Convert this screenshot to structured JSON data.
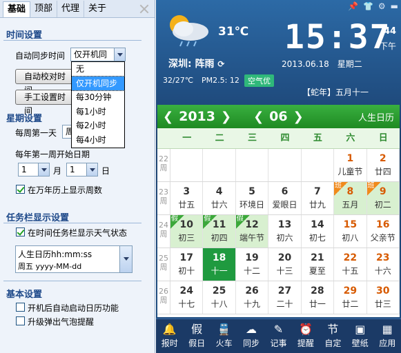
{
  "settings": {
    "tabs": [
      "基础",
      "顶部",
      "代理",
      "关于"
    ],
    "time_section": "时间设置",
    "auto_sync_label": "自动同步时间",
    "auto_sync_value": "仅开机同",
    "auto_correct_button": "自动校对时间",
    "manual_set_button": "手工设置时间",
    "sync_options": [
      "无",
      "仅开机同步",
      "每30分钟",
      "每1小时",
      "每2小时",
      "每4小时"
    ],
    "week_section": "星期设置",
    "first_day_label": "每周第一天",
    "first_day_value": "周",
    "first_week_label": "每年第一周开始日期",
    "month_value": "1",
    "month_label": "月",
    "day_value": "1",
    "day_label": "日",
    "show_week_label": "在万年历上显示周数",
    "taskbar_section": "任务栏显示设置",
    "show_weather_label": "在时间任务栏显示天气状态",
    "format_line1": "人生日历hh:mm:ss",
    "format_line2": "周五 yyyy-MM-dd",
    "basic_section": "基本设置",
    "autostart_label": "开机后自动启动日历功能",
    "upgrade_label": "升级弹出气泡提醒"
  },
  "weather": {
    "temperature": "31℃",
    "city": "深圳: 阵雨",
    "range": "32/27℃",
    "pm": "PM2.5: 12",
    "air_quality": "空气优"
  },
  "clock": {
    "time": "15:37",
    "seconds": "44",
    "ampm": "下午",
    "date": "2013.06.18",
    "weekday": "星期二",
    "lunar": "【蛇年】五月十一"
  },
  "calendar": {
    "year": "2013",
    "month": "06",
    "brand": "人生日历",
    "week_days": [
      "一",
      "二",
      "三",
      "四",
      "五",
      "六",
      "日"
    ],
    "rows": [
      {
        "week": "22 周",
        "days": [
          {
            "n": "",
            "l": ""
          },
          {
            "n": "",
            "l": ""
          },
          {
            "n": "",
            "l": ""
          },
          {
            "n": "",
            "l": ""
          },
          {
            "n": "",
            "l": ""
          },
          {
            "n": "1",
            "l": "儿童节",
            "we": true
          },
          {
            "n": "2",
            "l": "廿四",
            "we": true
          }
        ]
      },
      {
        "week": "23 周",
        "days": [
          {
            "n": "3",
            "l": "廿五"
          },
          {
            "n": "4",
            "l": "廿六"
          },
          {
            "n": "5",
            "l": "环境日"
          },
          {
            "n": "6",
            "l": "爱眼日"
          },
          {
            "n": "7",
            "l": "廿九"
          },
          {
            "n": "8",
            "l": "五月",
            "we": true,
            "hol": true,
            "tag": "班"
          },
          {
            "n": "9",
            "l": "初二",
            "we": true,
            "hol": true,
            "tag": "班"
          }
        ]
      },
      {
        "week": "24 周",
        "days": [
          {
            "n": "10",
            "l": "初三",
            "hol": true,
            "tag": "假"
          },
          {
            "n": "11",
            "l": "初四",
            "hol": true,
            "tag": "假"
          },
          {
            "n": "12",
            "l": "端午节",
            "hol": true,
            "tag": "假"
          },
          {
            "n": "13",
            "l": "初六"
          },
          {
            "n": "14",
            "l": "初七"
          },
          {
            "n": "15",
            "l": "初八",
            "we": true
          },
          {
            "n": "16",
            "l": "父亲节",
            "we": true
          }
        ]
      },
      {
        "week": "25 周",
        "days": [
          {
            "n": "17",
            "l": "初十"
          },
          {
            "n": "18",
            "l": "十一",
            "today": true
          },
          {
            "n": "19",
            "l": "十二"
          },
          {
            "n": "20",
            "l": "十三"
          },
          {
            "n": "21",
            "l": "夏至"
          },
          {
            "n": "22",
            "l": "十五",
            "we": true
          },
          {
            "n": "23",
            "l": "十六",
            "we": true
          }
        ]
      },
      {
        "week": "26 周",
        "days": [
          {
            "n": "24",
            "l": "十七"
          },
          {
            "n": "25",
            "l": "十八"
          },
          {
            "n": "26",
            "l": "十九"
          },
          {
            "n": "27",
            "l": "二十"
          },
          {
            "n": "28",
            "l": "廿一"
          },
          {
            "n": "29",
            "l": "廿二",
            "we": true
          },
          {
            "n": "30",
            "l": "廿三",
            "we": true
          }
        ]
      }
    ]
  },
  "toolbar": [
    "报时",
    "假日",
    "火车",
    "同步",
    "记事",
    "提醒",
    "自定",
    "壁纸",
    "应用"
  ],
  "toolbar_icons": [
    "🔔",
    "假",
    "🚆",
    "☁",
    "✎",
    "⏰",
    "节",
    "▣",
    "▦"
  ]
}
